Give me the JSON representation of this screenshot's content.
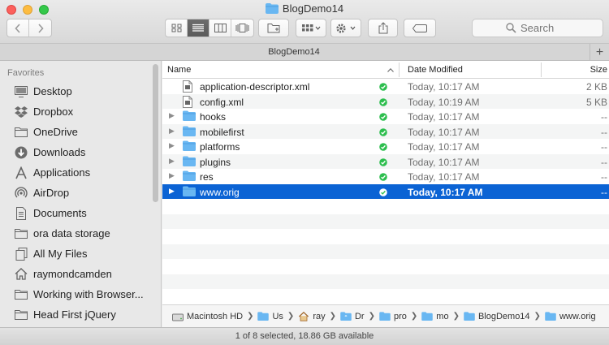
{
  "window": {
    "title": "BlogDemo14"
  },
  "toolbar": {
    "search_placeholder": "Search",
    "views": [
      "icon-view",
      "list-view",
      "column-view",
      "cover-flow-view"
    ],
    "active_view": "list-view"
  },
  "tabbar": {
    "label": "BlogDemo14",
    "add_label": "+"
  },
  "sidebar": {
    "heading": "Favorites",
    "items": [
      {
        "label": "Desktop",
        "icon": "desktop-icon"
      },
      {
        "label": "Dropbox",
        "icon": "dropbox-icon"
      },
      {
        "label": "OneDrive",
        "icon": "folder-icon"
      },
      {
        "label": "Downloads",
        "icon": "downloads-icon"
      },
      {
        "label": "Applications",
        "icon": "applications-icon"
      },
      {
        "label": "AirDrop",
        "icon": "airdrop-icon"
      },
      {
        "label": "Documents",
        "icon": "documents-icon"
      },
      {
        "label": "ora data storage",
        "icon": "folder-icon"
      },
      {
        "label": "All My Files",
        "icon": "all-files-icon"
      },
      {
        "label": "raymondcamden",
        "icon": "home-icon"
      },
      {
        "label": "Working with Browser...",
        "icon": "folder-icon"
      },
      {
        "label": "Head First jQuery",
        "icon": "folder-icon"
      }
    ]
  },
  "columns": {
    "name": "Name",
    "date": "Date Modified",
    "size": "Size"
  },
  "files": [
    {
      "name": "application-descriptor.xml",
      "type": "file",
      "date": "Today, 10:17 AM",
      "size": "2 KB",
      "selected": false
    },
    {
      "name": "config.xml",
      "type": "file",
      "date": "Today, 10:19 AM",
      "size": "5 KB",
      "selected": false
    },
    {
      "name": "hooks",
      "type": "folder",
      "date": "Today, 10:17 AM",
      "size": "--",
      "selected": false
    },
    {
      "name": "mobilefirst",
      "type": "folder",
      "date": "Today, 10:17 AM",
      "size": "--",
      "selected": false
    },
    {
      "name": "platforms",
      "type": "folder",
      "date": "Today, 10:17 AM",
      "size": "--",
      "selected": false
    },
    {
      "name": "plugins",
      "type": "folder",
      "date": "Today, 10:17 AM",
      "size": "--",
      "selected": false
    },
    {
      "name": "res",
      "type": "folder",
      "date": "Today, 10:17 AM",
      "size": "--",
      "selected": false
    },
    {
      "name": "www.orig",
      "type": "folder",
      "date": "Today, 10:17 AM",
      "size": "--",
      "selected": true
    }
  ],
  "pathbar": [
    {
      "label": "Macintosh HD",
      "icon": "hard-drive-icon"
    },
    {
      "label": "Us",
      "icon": "folder-icon"
    },
    {
      "label": "ray",
      "icon": "home-icon"
    },
    {
      "label": "Dr",
      "icon": "dropbox-folder-icon"
    },
    {
      "label": "pro",
      "icon": "folder-icon"
    },
    {
      "label": "mo",
      "icon": "folder-icon"
    },
    {
      "label": "BlogDemo14",
      "icon": "folder-icon"
    },
    {
      "label": "www.orig",
      "icon": "folder-icon"
    }
  ],
  "status": {
    "text": "1 of 8 selected, 18.86 GB available"
  },
  "colors": {
    "selection": "#0b63d4",
    "folder": "#69b7f2",
    "sync_check": "#2dbe4e"
  }
}
